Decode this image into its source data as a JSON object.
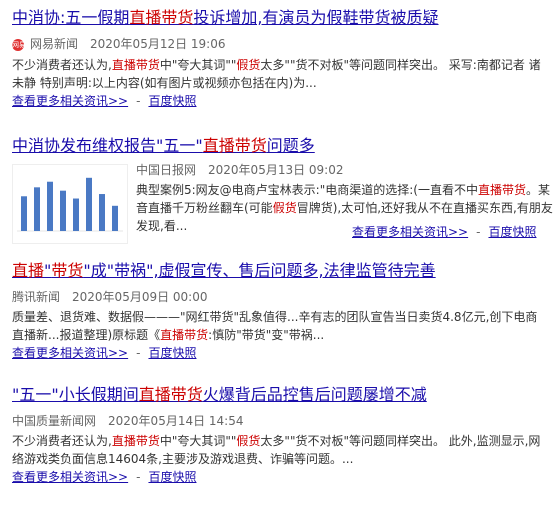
{
  "results": [
    {
      "title_parts": [
        {
          "text": "中消协:五一假期",
          "hl": false
        },
        {
          "text": "直播带货",
          "hl": true
        },
        {
          "text": "投诉增加,有演员为假鞋带货被质疑",
          "hl": false
        }
      ],
      "favicon_text": "网易",
      "source": "网易新闻",
      "date": "2020年05月12日 19:06",
      "snippet_parts": [
        {
          "text": "不少消费者还认为,",
          "hl": false
        },
        {
          "text": "直播带货",
          "hl": true
        },
        {
          "text": "中\"夸大其词\"\"",
          "hl": false
        },
        {
          "text": "假货",
          "hl": true
        },
        {
          "text": "太多\"\"货不对板\"等问题同样突出。 采写:南都记者 诸未静 特别声明:以上内容(如有图片或视频亦包括在内)为...",
          "hl": false
        }
      ],
      "more_link": "查看更多相关资讯>>",
      "dash": "-",
      "cache_link": "百度快照"
    },
    {
      "title_parts": [
        {
          "text": "中消协发布维权报告\"五一\"",
          "hl": false
        },
        {
          "text": "直播带货",
          "hl": true
        },
        {
          "text": "问题多",
          "hl": false
        }
      ],
      "source": "中国日报网",
      "date": "2020年05月13日 09:02",
      "snippet_parts": [
        {
          "text": "典型案例5:网友@电商卢宝林表示:\"电商渠道的选择:(一直看不中",
          "hl": false
        },
        {
          "text": "直播带货",
          "hl": true
        },
        {
          "text": "。某音直播千万粉丝翻车(可能",
          "hl": false
        },
        {
          "text": "假货",
          "hl": true
        },
        {
          "text": "冒牌货),太可怕,还好我从不在直播买东西,有朋友发现,看...",
          "hl": false
        }
      ],
      "more_link": "查看更多相关资讯>>",
      "dash": "-",
      "cache_link": "百度快照",
      "thumb_bars": [
        0.62,
        0.78,
        0.88,
        0.72,
        0.58,
        0.95,
        0.66,
        0.45
      ]
    },
    {
      "title_parts": [
        {
          "text": "直播",
          "hl": true
        },
        {
          "text": "\"",
          "hl": false
        },
        {
          "text": "带货",
          "hl": true
        },
        {
          "text": "\"成\"带祸\",虚假宣传、售后问题多,法律监管待完善",
          "hl": false
        }
      ],
      "source": "腾讯新闻",
      "date": "2020年05月09日 00:00",
      "snippet_parts": [
        {
          "text": "质量差、退货难、数据假———\"网红带货\"乱象值得...辛有志的团队宣告当日卖货4.8亿元,创下电商直播新...报道整理)原标题《",
          "hl": false
        },
        {
          "text": "直播带货",
          "hl": true
        },
        {
          "text": ":慎防\"带货\"变\"带祸...",
          "hl": false
        }
      ],
      "more_link": "查看更多相关资讯>>",
      "dash": "-",
      "cache_link": "百度快照"
    },
    {
      "title_parts": [
        {
          "text": "\"五一\"小长假期间",
          "hl": false
        },
        {
          "text": "直播带货",
          "hl": true
        },
        {
          "text": "火爆背后品控售后问题屡增不减",
          "hl": false
        }
      ],
      "source": "中国质量新闻网",
      "date": "2020年05月14日 14:54",
      "snippet_parts": [
        {
          "text": "不少消费者还认为,",
          "hl": false
        },
        {
          "text": "直播带货",
          "hl": true
        },
        {
          "text": "中\"夸大其词\"\"",
          "hl": false
        },
        {
          "text": "假货",
          "hl": true
        },
        {
          "text": "太多\"\"货不对板\"等问题同样突出。 此外,监测显示,网络游戏类负面信息14604条,主要涉及游戏退费、诈骗等问题。...",
          "hl": false
        }
      ],
      "more_link": "查看更多相关资讯>>",
      "dash": "-",
      "cache_link": "百度快照"
    }
  ],
  "colors": {
    "link": "#1a0dab",
    "highlight": "#cc0000",
    "thumb_bar": "#4a79c4"
  }
}
